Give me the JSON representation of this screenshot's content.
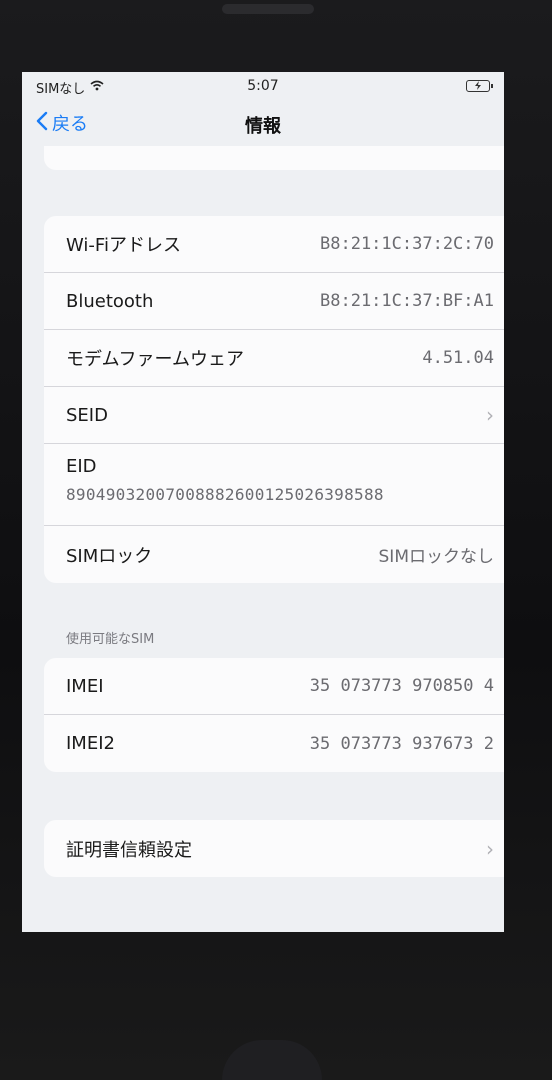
{
  "status_bar": {
    "carrier": "SIMなし",
    "time": "5:07"
  },
  "nav": {
    "back_label": "戻る",
    "title": "情報"
  },
  "network_group": {
    "rows": [
      {
        "label": "Wi-Fiアドレス",
        "value": "B8:21:1C:37:2C:70"
      },
      {
        "label": "Bluetooth",
        "value": "B8:21:1C:37:BF:A1"
      },
      {
        "label": "モデムファームウェア",
        "value": "4.51.04"
      },
      {
        "label": "SEID",
        "chevron": "›"
      },
      {
        "label": "EID",
        "value": "89049032007008882600125026398588"
      },
      {
        "label": "SIMロック",
        "value": "SIMロックなし"
      }
    ]
  },
  "sim_section": {
    "header": "使用可能なSIM",
    "rows": [
      {
        "label": "IMEI",
        "value": "35 073773 970850 4"
      },
      {
        "label": "IMEI2",
        "value": "35 073773 937673 2"
      }
    ]
  },
  "cert_group": {
    "label": "証明書信頼設定",
    "chevron": "›"
  },
  "colors": {
    "accent": "#1a7cf5",
    "background": "#eef0f3",
    "cell": "#fbfbfc"
  },
  "icons": [
    "wifi-icon",
    "battery-charging-icon",
    "chevron-left-icon",
    "chevron-right-icon"
  ]
}
